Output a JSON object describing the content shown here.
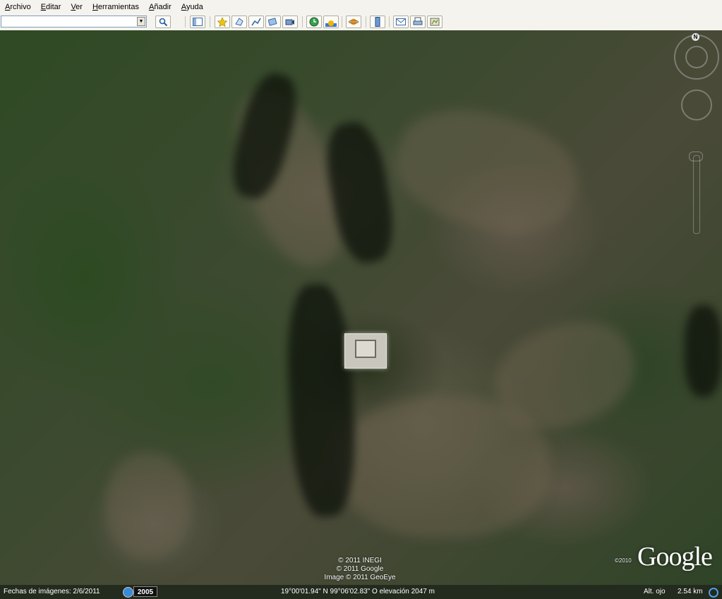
{
  "menu": {
    "items": [
      "Archivo",
      "Editar",
      "Ver",
      "Herramientas",
      "Añadir",
      "Ayuda"
    ]
  },
  "toolbar": {
    "search_value": "",
    "search_placeholder": "",
    "buttons": [
      "search-button",
      "sidebar-toggle",
      "placemark",
      "polygon",
      "path",
      "image-overlay",
      "record-tour",
      "historical-imagery",
      "sunlight",
      "planets",
      "ruler",
      "email",
      "print",
      "view-in-maps"
    ]
  },
  "map": {
    "attribution": [
      "© 2011 INEGI",
      "© 2011 Google",
      "Image © 2011 GeoEye"
    ],
    "logo": "Google",
    "logo_year": "©2010",
    "north_label": "N"
  },
  "status": {
    "imagery_date": "Fechas de imágenes: 2/6/2011",
    "year": "2005",
    "coords": "19°00'01.94\" N  99°06'02.83\" O  elevación 2047 m",
    "eye_alt_label": "Alt. ojo",
    "eye_alt_value": "2.54 km"
  },
  "colors": {
    "menu_bg": "#f4f3ee",
    "status_bg": "#232a1e",
    "forest": "#2f4a24",
    "rock": "#5a5a45"
  }
}
